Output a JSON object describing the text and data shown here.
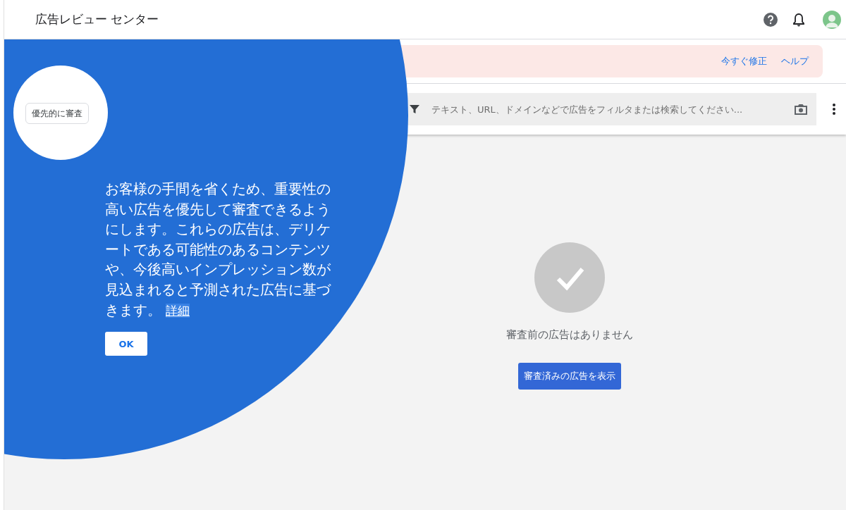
{
  "header": {
    "title": "広告レビュー センター"
  },
  "alert": {
    "actions": [
      "今すぐ修正",
      "ヘルプ"
    ]
  },
  "search": {
    "placeholder": "テキスト、URL、ドメインなどで広告をフィルタまたは検索してください..."
  },
  "empty_state": {
    "message": "審査前の広告はありません",
    "button": "審査済みの広告を表示"
  },
  "tour": {
    "chip": "優先的に審査",
    "text": "お客様の手間を省くため、重要性の高い広告を優先して審査できるようにします。これらの広告は、デリケートである可能性のあるコンテンツや、今後高いインプレッション数が見込まれると予測された広告に基づきます。",
    "link": "詳細",
    "button": "OK"
  }
}
